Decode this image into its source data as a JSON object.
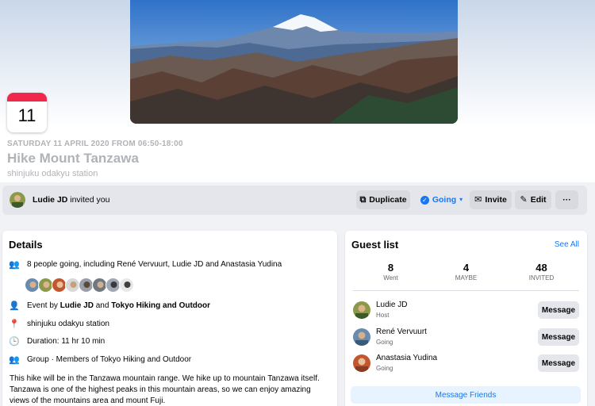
{
  "event": {
    "badge_day": "11",
    "date_line": "SATURDAY 11 APRIL 2020 FROM 06:50-18:00",
    "title": "Hike Mount Tanzawa",
    "location": "shinjuku odakyu station"
  },
  "action_bar": {
    "inviter_name": "Ludie JD",
    "inviter_suffix": " invited you",
    "duplicate": "Duplicate",
    "going": "Going",
    "invite": "Invite",
    "edit": "Edit",
    "more": "···"
  },
  "details": {
    "title": "Details",
    "going_text": "8 people going, including René Vervuurt, Ludie JD and Anastasia Yudina",
    "event_by_prefix": "Event by ",
    "event_by_person": "Ludie JD",
    "event_by_and": " and ",
    "event_by_group": "Tokyo Hiking and Outdoor",
    "location": "shinjuku odakyu station",
    "duration": "Duration: 11 hr 10 min",
    "group": "Group · Members of Tokyo Hiking and Outdoor",
    "description": "This hike will be in the Tanzawa mountain range. We hike up to mountain Tanzawa itself. Tanzawa is one of the highest peaks in this mountain areas, so we can enjoy amazing views of the mountains area and mount Fuji."
  },
  "guests": {
    "title": "Guest list",
    "see_all": "See All",
    "stats": [
      {
        "n": "8",
        "l": "Went"
      },
      {
        "n": "4",
        "l": "MAYBE"
      },
      {
        "n": "48",
        "l": "INVITED"
      }
    ],
    "list": [
      {
        "name": "Ludie JD",
        "role": "Host",
        "button": "Message"
      },
      {
        "name": "René Vervuurt",
        "role": "Going",
        "button": "Message"
      },
      {
        "name": "Anastasia Yudina",
        "role": "Going",
        "button": "Message"
      }
    ],
    "message_friends": "Message Friends"
  },
  "colors": {
    "accent": "#1877f2",
    "badge_red": "#f02849",
    "muted": "#b0b3b8"
  },
  "icons": {
    "duplicate": "duplicate-icon",
    "going": "check-circle-icon",
    "invite": "envelope-icon",
    "edit": "pencil-icon",
    "people": "people-icon",
    "person": "person-icon",
    "location": "pin-icon",
    "duration": "clock-icon",
    "group": "group-icon"
  }
}
